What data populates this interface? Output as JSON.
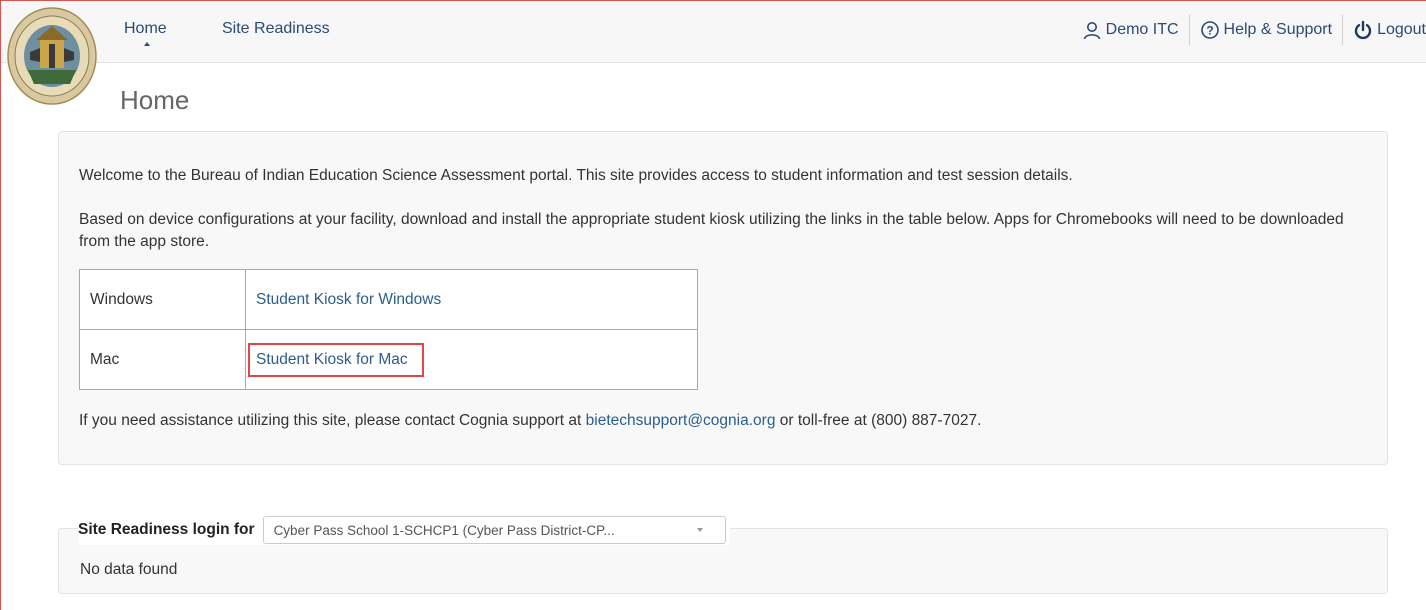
{
  "nav": {
    "home": "Home",
    "site_readiness": "Site Readiness"
  },
  "logo": {
    "alt_text": "Bureau of Indian Education"
  },
  "userbar": {
    "user": "Demo ITC",
    "help": "Help & Support",
    "logout": "Logout"
  },
  "page": {
    "title": "Home"
  },
  "welcome": {
    "intro": "Welcome to the Bureau of Indian Education Science Assessment portal. This site provides access to student information and test session details.",
    "instructions": "Based on device configurations at your facility, download and install the appropriate student kiosk utilizing the links in the table below. Apps for Chromebooks will need to be downloaded from the app store.",
    "kiosks": [
      {
        "os": "Windows",
        "link": "Student Kiosk for Windows"
      },
      {
        "os": "Mac",
        "link": "Student Kiosk for Mac"
      }
    ],
    "support_prefix": "If you need assistance utilizing this site, please contact Cognia support at ",
    "support_email": "bietechsupport@cognia.org",
    "support_suffix": " or toll-free at (800) 887-7027."
  },
  "site_readiness": {
    "label": "Site Readiness login for",
    "selected": "Cyber Pass School 1-SCHCP1 (Cyber Pass District-CP...",
    "empty_message": "No data found"
  },
  "colors": {
    "link": "#2c5d8f",
    "nav": "#2c4a73",
    "highlight": "#e04848"
  }
}
